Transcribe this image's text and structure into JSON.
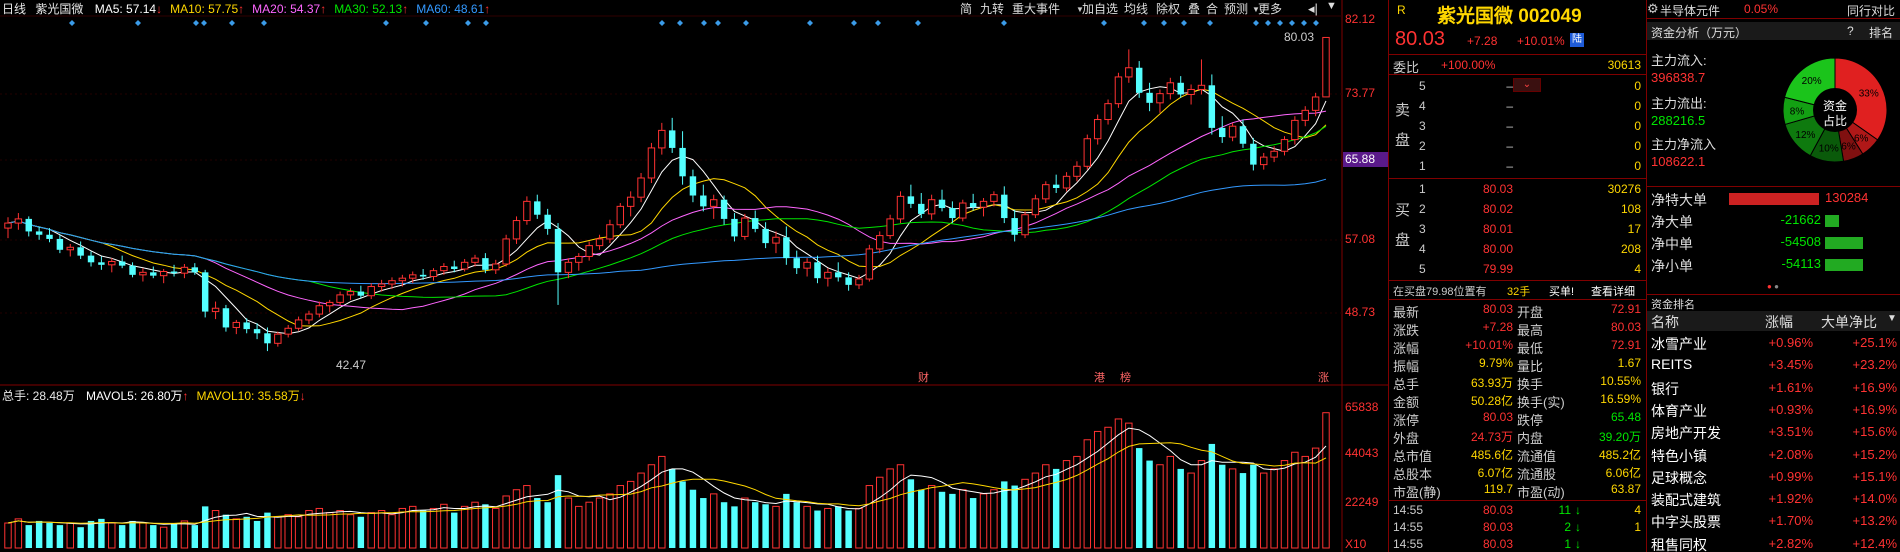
{
  "chart": {
    "period_label": "日线",
    "stock_name": "紫光国微",
    "ma": [
      {
        "label": "MA5: 57.14",
        "arrow": "↓",
        "color": "#ffffff"
      },
      {
        "label": "MA10: 57.75",
        "arrow": "↑",
        "color": "#ffd700"
      },
      {
        "label": "MA20: 54.37",
        "arrow": "↑",
        "color": "#ff66ff"
      },
      {
        "label": "MA30: 52.13",
        "arrow": "↑",
        "color": "#00e600"
      },
      {
        "label": "MA60: 48.61",
        "arrow": "↑",
        "color": "#3399ff"
      }
    ],
    "price_axis": [
      "82.12",
      "73.77",
      "65.88",
      "57.08",
      "48.73"
    ],
    "current_price_tag": "65.88",
    "high_label": "80.03",
    "low_label": "42.47",
    "event_markers": [
      "财",
      "港",
      "榜",
      "涨"
    ],
    "vol_title": "总手: 28.48万",
    "vol_ma": [
      {
        "label": "MAVOL5: 26.80万",
        "arrow": "↑",
        "color": "#ffffff"
      },
      {
        "label": "MAVOL10: 35.58万",
        "arrow": "↓",
        "color": "#ffd700"
      }
    ],
    "vol_axis": [
      "65838",
      "44043",
      "22249",
      "X10"
    ]
  },
  "toolbar": {
    "items": [
      "简",
      "九转",
      "重大事件",
      "加自选",
      "均线",
      "除权",
      "叠",
      "合",
      "预测",
      "更多"
    ]
  },
  "quote": {
    "r_badge": "R",
    "name_code": "紫光国微 002049",
    "price": "80.03",
    "change": "+7.28",
    "change_pct": "+10.01%",
    "lu_badge": "陆",
    "weibi_label": "委比",
    "weibi_value": "+100.00%",
    "weicha_value": "30613",
    "sell_label": "卖盘",
    "buy_label": "买盘",
    "sell": [
      {
        "lvl": "5",
        "price": "–",
        "vol": "0"
      },
      {
        "lvl": "4",
        "price": "–",
        "vol": "0"
      },
      {
        "lvl": "3",
        "price": "–",
        "vol": "0"
      },
      {
        "lvl": "2",
        "price": "–",
        "vol": "0"
      },
      {
        "lvl": "1",
        "price": "–",
        "vol": "0"
      }
    ],
    "buy": [
      {
        "lvl": "1",
        "price": "80.03",
        "vol": "30276"
      },
      {
        "lvl": "2",
        "price": "80.02",
        "vol": "108"
      },
      {
        "lvl": "3",
        "price": "80.01",
        "vol": "17"
      },
      {
        "lvl": "4",
        "price": "80.00",
        "vol": "208"
      },
      {
        "lvl": "5",
        "price": "79.99",
        "vol": "4"
      }
    ],
    "buy_info": "在买盘79.98位置有",
    "buy_info_qty": "32手",
    "buy_info_action": "买单!",
    "buy_info_link": "查看详细",
    "stats": [
      [
        "最新",
        "80.03",
        "开盘",
        "72.91"
      ],
      [
        "涨跌",
        "+7.28",
        "最高",
        "80.03"
      ],
      [
        "涨幅",
        "+10.01%",
        "最低",
        "72.91"
      ],
      [
        "振幅",
        "9.79%",
        "量比",
        "1.67"
      ],
      [
        "总手",
        "63.93万",
        "换手",
        "10.55%"
      ],
      [
        "金额",
        "50.28亿",
        "换手(实)",
        "16.59%"
      ],
      [
        "涨停",
        "80.03",
        "跌停",
        "65.48"
      ],
      [
        "外盘",
        "24.73万",
        "内盘",
        "39.20万"
      ],
      [
        "总市值",
        "485.6亿",
        "流通值",
        "485.2亿"
      ],
      [
        "总股本",
        "6.07亿",
        "流通股",
        "6.06亿"
      ],
      [
        "市盈(静)",
        "119.7",
        "市盈(动)",
        "63.87"
      ]
    ],
    "ticks": [
      {
        "time": "14:55",
        "price": "80.03",
        "vol": "11",
        "dir": "down",
        "n": "4"
      },
      {
        "time": "14:55",
        "price": "80.03",
        "vol": "2",
        "dir": "down",
        "n": "1"
      },
      {
        "time": "14:55",
        "price": "80.03",
        "vol": "1",
        "dir": "down",
        "n": ""
      }
    ]
  },
  "fund": {
    "sector": "半导体元件",
    "sector_pct": "0.05%",
    "compare_label": "同行对比",
    "title": "资金分析（万元）",
    "rank_label": "排名",
    "in_label": "主力流入:",
    "in_value": "396838.7",
    "out_label": "主力流出:",
    "out_value": "288216.5",
    "net_label": "主力净流入",
    "net_value": "108622.1",
    "donut_center": [
      "资金",
      "占比"
    ],
    "donut": [
      {
        "pct": 33,
        "label": "33%",
        "color": "#e02020"
      },
      {
        "pct": 6,
        "label": "6%",
        "color": "#b01818"
      },
      {
        "pct": 6,
        "label": "6%",
        "color": "#801010"
      },
      {
        "pct": 10,
        "label": "10%",
        "color": "#0a5a0a"
      },
      {
        "pct": 12,
        "label": "12%",
        "color": "#0e7a0e"
      },
      {
        "pct": 8,
        "label": "8%",
        "color": "#13a013"
      },
      {
        "pct": 20,
        "label": "20%",
        "color": "#1bc41b"
      }
    ],
    "flows": [
      {
        "label": "净特大单",
        "value": "130284",
        "ratio": 1.0,
        "color": "#cc2222"
      },
      {
        "label": "净大单",
        "value": "-21662",
        "ratio": 0.16,
        "color": "#22aa22"
      },
      {
        "label": "净中单",
        "value": "-54508",
        "ratio": 0.42,
        "color": "#22aa22"
      },
      {
        "label": "净小单",
        "value": "-54113",
        "ratio": 0.42,
        "color": "#22aa22"
      }
    ],
    "rank_title": "资金排名",
    "rank_headers": [
      "名称",
      "涨幅",
      "大单净比"
    ],
    "rank_rows": [
      [
        "冰雪产业",
        "+0.96%",
        "+25.1%"
      ],
      [
        "REITS",
        "+3.45%",
        "+23.2%"
      ],
      [
        "银行",
        "+1.61%",
        "+16.9%"
      ],
      [
        "体育产业",
        "+0.93%",
        "+16.9%"
      ],
      [
        "房地产开发",
        "+3.51%",
        "+15.6%"
      ],
      [
        "特色小镇",
        "+2.08%",
        "+15.2%"
      ],
      [
        "足球概念",
        "+0.99%",
        "+15.1%"
      ],
      [
        "装配式建筑",
        "+1.92%",
        "+14.0%"
      ],
      [
        "中字头股票",
        "+1.70%",
        "+13.2%"
      ],
      [
        "租售同权",
        "+2.82%",
        "+12.4%"
      ]
    ]
  },
  "chart_data": {
    "type": "candlestick",
    "price_ylim": [
      42.0,
      82.12
    ],
    "candles": [
      [
        57.2,
        58.5,
        56.0,
        57.8
      ],
      [
        57.8,
        59.0,
        57.0,
        58.3
      ],
      [
        58.3,
        58.6,
        56.2,
        56.8
      ],
      [
        56.8,
        57.4,
        55.8,
        56.4
      ],
      [
        56.4,
        57.2,
        55.5,
        55.9
      ],
      [
        55.9,
        56.4,
        54.2,
        54.6
      ],
      [
        54.6,
        55.3,
        53.8,
        54.9
      ],
      [
        54.9,
        55.6,
        53.5,
        53.9
      ],
      [
        53.9,
        54.4,
        52.6,
        53.1
      ],
      [
        53.1,
        53.8,
        52.2,
        52.8
      ],
      [
        52.8,
        53.6,
        51.9,
        53.2
      ],
      [
        53.2,
        53.9,
        52.4,
        52.7
      ],
      [
        52.7,
        53.1,
        51.3,
        51.6
      ],
      [
        51.6,
        52.4,
        50.8,
        51.9
      ],
      [
        51.9,
        52.6,
        51.2,
        51.5
      ],
      [
        51.5,
        52.3,
        50.6,
        52.0
      ],
      [
        52.0,
        52.8,
        51.4,
        51.8
      ],
      [
        51.8,
        52.9,
        51.2,
        52.5
      ],
      [
        52.5,
        53.0,
        51.6,
        51.9
      ],
      [
        51.9,
        52.2,
        46.5,
        47.2
      ],
      [
        47.2,
        48.4,
        46.3,
        47.6
      ],
      [
        47.6,
        48.0,
        44.8,
        45.3
      ],
      [
        45.3,
        46.2,
        44.5,
        45.9
      ],
      [
        45.9,
        46.4,
        44.6,
        45.1
      ],
      [
        45.1,
        45.8,
        43.9,
        44.6
      ],
      [
        44.6,
        45.3,
        42.47,
        43.4
      ],
      [
        43.4,
        44.8,
        43.0,
        44.5
      ],
      [
        44.5,
        45.6,
        44.1,
        45.2
      ],
      [
        45.2,
        46.6,
        44.9,
        46.2
      ],
      [
        46.2,
        47.3,
        45.7,
        46.9
      ],
      [
        46.9,
        48.4,
        46.5,
        47.9
      ],
      [
        47.9,
        48.6,
        47.1,
        48.3
      ],
      [
        48.3,
        49.6,
        47.9,
        49.2
      ],
      [
        49.2,
        50.0,
        48.6,
        49.6
      ],
      [
        49.6,
        50.3,
        48.8,
        49.1
      ],
      [
        49.1,
        50.6,
        48.7,
        50.2
      ],
      [
        50.2,
        51.0,
        49.6,
        50.5
      ],
      [
        50.5,
        51.3,
        49.9,
        50.9
      ],
      [
        50.9,
        51.6,
        50.2,
        51.2
      ],
      [
        51.2,
        52.0,
        50.6,
        51.6
      ],
      [
        51.6,
        52.3,
        51.0,
        51.4
      ],
      [
        51.4,
        52.4,
        50.9,
        52.1
      ],
      [
        52.1,
        53.0,
        51.6,
        52.6
      ],
      [
        52.6,
        53.3,
        51.9,
        52.3
      ],
      [
        52.3,
        53.5,
        52.0,
        53.1
      ],
      [
        53.1,
        54.0,
        52.6,
        53.6
      ],
      [
        53.6,
        54.2,
        51.8,
        52.2
      ],
      [
        52.2,
        53.4,
        51.7,
        52.9
      ],
      [
        52.9,
        56.4,
        52.6,
        55.9
      ],
      [
        55.9,
        58.6,
        55.3,
        58.1
      ],
      [
        58.1,
        61.0,
        57.6,
        60.4
      ],
      [
        60.4,
        61.2,
        58.3,
        58.8
      ],
      [
        58.8,
        59.5,
        56.4,
        57.1
      ],
      [
        57.1,
        57.8,
        48.0,
        51.9
      ],
      [
        51.9,
        53.6,
        51.2,
        53.1
      ],
      [
        53.1,
        54.2,
        52.1,
        53.8
      ],
      [
        53.8,
        55.6,
        53.3,
        55.1
      ],
      [
        55.1,
        56.4,
        54.6,
        55.9
      ],
      [
        55.9,
        58.2,
        55.4,
        57.6
      ],
      [
        57.6,
        60.2,
        57.2,
        59.8
      ],
      [
        59.8,
        61.6,
        58.6,
        60.9
      ],
      [
        60.9,
        63.8,
        60.3,
        63.2
      ],
      [
        63.2,
        67.4,
        62.6,
        66.8
      ],
      [
        66.8,
        69.8,
        66.0,
        68.9
      ],
      [
        68.9,
        70.4,
        66.2,
        66.8
      ],
      [
        66.8,
        68.8,
        62.4,
        63.4
      ],
      [
        63.4,
        64.2,
        60.3,
        61.1
      ],
      [
        61.1,
        62.4,
        59.2,
        59.8
      ],
      [
        59.8,
        61.2,
        58.3,
        60.6
      ],
      [
        60.6,
        61.1,
        57.6,
        58.3
      ],
      [
        58.3,
        59.0,
        55.6,
        56.2
      ],
      [
        56.2,
        58.9,
        55.8,
        58.4
      ],
      [
        58.4,
        59.3,
        56.7,
        57.1
      ],
      [
        57.1,
        57.9,
        54.8,
        55.4
      ],
      [
        55.4,
        56.8,
        54.2,
        56.1
      ],
      [
        56.1,
        57.4,
        52.8,
        53.6
      ],
      [
        53.6,
        54.5,
        51.7,
        52.4
      ],
      [
        52.4,
        53.6,
        51.4,
        53.1
      ],
      [
        53.1,
        53.9,
        50.6,
        51.2
      ],
      [
        51.2,
        52.4,
        50.2,
        51.9
      ],
      [
        51.9,
        53.1,
        50.8,
        51.3
      ],
      [
        51.3,
        51.9,
        49.7,
        50.4
      ],
      [
        50.4,
        51.6,
        49.9,
        51.1
      ],
      [
        51.1,
        55.2,
        50.8,
        54.7
      ],
      [
        54.7,
        56.8,
        54.2,
        56.3
      ],
      [
        56.3,
        58.8,
        55.9,
        58.3
      ],
      [
        58.3,
        61.6,
        57.8,
        61.0
      ],
      [
        61.0,
        62.4,
        59.6,
        60.1
      ],
      [
        60.1,
        61.4,
        58.4,
        58.9
      ],
      [
        58.9,
        61.2,
        58.2,
        60.6
      ],
      [
        60.6,
        61.8,
        59.2,
        59.6
      ],
      [
        59.6,
        60.4,
        57.8,
        58.4
      ],
      [
        58.4,
        60.6,
        58.0,
        60.2
      ],
      [
        60.2,
        61.3,
        59.3,
        59.7
      ],
      [
        59.7,
        60.8,
        58.6,
        60.4
      ],
      [
        60.4,
        61.6,
        59.8,
        61.2
      ],
      [
        61.2,
        62.2,
        57.8,
        58.4
      ],
      [
        58.4,
        59.4,
        55.6,
        56.4
      ],
      [
        56.4,
        59.2,
        56.0,
        58.8
      ],
      [
        58.8,
        61.2,
        58.4,
        60.7
      ],
      [
        60.7,
        62.8,
        60.2,
        62.4
      ],
      [
        62.4,
        63.6,
        61.4,
        62.0
      ],
      [
        62.0,
        63.9,
        61.6,
        63.4
      ],
      [
        63.4,
        65.2,
        62.8,
        64.6
      ],
      [
        64.6,
        68.4,
        64.2,
        67.9
      ],
      [
        67.9,
        70.8,
        67.2,
        70.2
      ],
      [
        70.2,
        72.6,
        69.6,
        72.1
      ],
      [
        72.1,
        75.8,
        71.6,
        75.3
      ],
      [
        75.3,
        78.6,
        74.6,
        76.4
      ],
      [
        76.4,
        77.2,
        72.8,
        73.4
      ],
      [
        73.4,
        74.6,
        71.2,
        72.2
      ],
      [
        72.2,
        73.8,
        71.0,
        73.3
      ],
      [
        73.3,
        75.2,
        72.6,
        74.6
      ],
      [
        74.6,
        75.4,
        72.8,
        73.2
      ],
      [
        73.2,
        74.4,
        72.0,
        73.8
      ],
      [
        73.8,
        77.4,
        73.2,
        74.3
      ],
      [
        74.3,
        75.6,
        68.4,
        69.2
      ],
      [
        69.2,
        70.6,
        67.4,
        68.1
      ],
      [
        68.1,
        69.8,
        67.6,
        69.4
      ],
      [
        69.4,
        70.2,
        66.8,
        67.3
      ],
      [
        67.3,
        68.0,
        64.1,
        64.8
      ],
      [
        64.8,
        66.2,
        64.2,
        65.7
      ],
      [
        65.7,
        67.0,
        65.1,
        66.4
      ],
      [
        66.4,
        68.2,
        65.9,
        67.8
      ],
      [
        67.8,
        70.6,
        67.2,
        70.1
      ],
      [
        70.1,
        71.8,
        69.4,
        71.3
      ],
      [
        71.3,
        73.4,
        70.6,
        72.9
      ],
      [
        72.91,
        80.03,
        72.91,
        80.03
      ]
    ],
    "volumes": [
      12,
      14,
      11,
      13,
      12,
      11,
      12,
      10,
      13,
      14,
      12,
      11,
      13,
      12,
      11,
      10,
      12,
      13,
      11,
      20,
      18,
      16,
      14,
      15,
      13,
      17,
      15,
      16,
      15,
      18,
      19,
      17,
      18,
      16,
      15,
      17,
      18,
      16,
      19,
      20,
      18,
      19,
      21,
      17,
      20,
      22,
      21,
      19,
      25,
      28,
      30,
      24,
      22,
      35,
      24,
      20,
      22,
      24,
      26,
      30,
      32,
      36,
      40,
      44,
      38,
      32,
      28,
      24,
      26,
      22,
      20,
      24,
      22,
      21,
      20,
      26,
      22,
      20,
      18,
      19,
      20,
      18,
      19,
      30,
      34,
      38,
      40,
      33,
      28,
      30,
      27,
      26,
      28,
      24,
      26,
      28,
      32,
      30,
      33,
      36,
      40,
      38,
      42,
      44,
      52,
      56,
      58,
      62,
      60,
      48,
      42,
      40,
      44,
      38,
      36,
      42,
      50,
      40,
      38,
      36,
      40,
      36,
      38,
      42,
      46,
      44,
      48,
      65
    ],
    "vol_ylim": [
      0,
      70000
    ],
    "x_axis": "trading days (dates not shown)"
  }
}
